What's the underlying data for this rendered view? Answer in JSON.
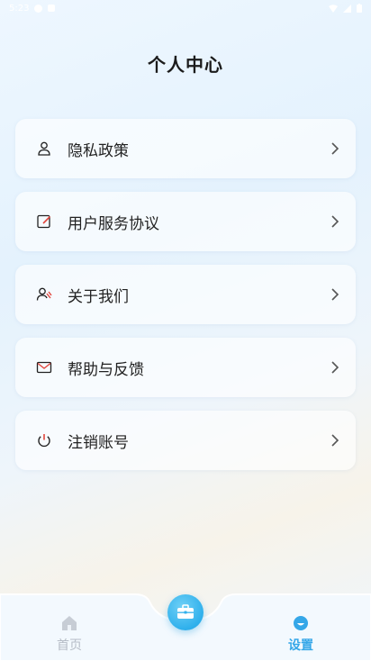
{
  "status_bar": {
    "time": "5:23"
  },
  "page": {
    "title": "个人中心"
  },
  "menu": [
    {
      "label": "隐私政策",
      "icon": "user-shield-icon"
    },
    {
      "label": "用户服务协议",
      "icon": "edit-document-icon"
    },
    {
      "label": "关于我们",
      "icon": "users-icon"
    },
    {
      "label": "帮助与反馈",
      "icon": "mail-icon"
    },
    {
      "label": "注销账号",
      "icon": "power-icon"
    }
  ],
  "tabs": {
    "home": {
      "label": "首页",
      "active": false
    },
    "settings": {
      "label": "设置",
      "active": true
    }
  },
  "colors": {
    "accent": "#35a7e8",
    "inactive": "#b5bcc6",
    "text": "#222222"
  }
}
